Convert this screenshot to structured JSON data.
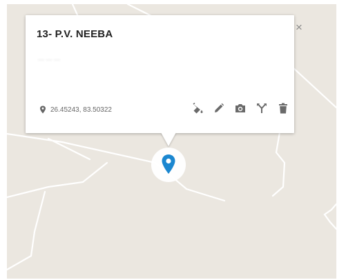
{
  "popup": {
    "title": "13- P.V. NEEBA",
    "subtitle": "— — —",
    "close_label": "×",
    "coordinates": "26.45243, 83.50322"
  },
  "actions": [
    {
      "icon": "paint-bucket-icon"
    },
    {
      "icon": "pencil-icon"
    },
    {
      "icon": "camera-icon"
    },
    {
      "icon": "fork-icon"
    },
    {
      "icon": "trash-icon"
    }
  ],
  "marker": {
    "icon": "location-pin-icon",
    "color": "#1b87d0"
  },
  "colors": {
    "map_background": "#ebe7e0",
    "road": "#ffffff"
  }
}
